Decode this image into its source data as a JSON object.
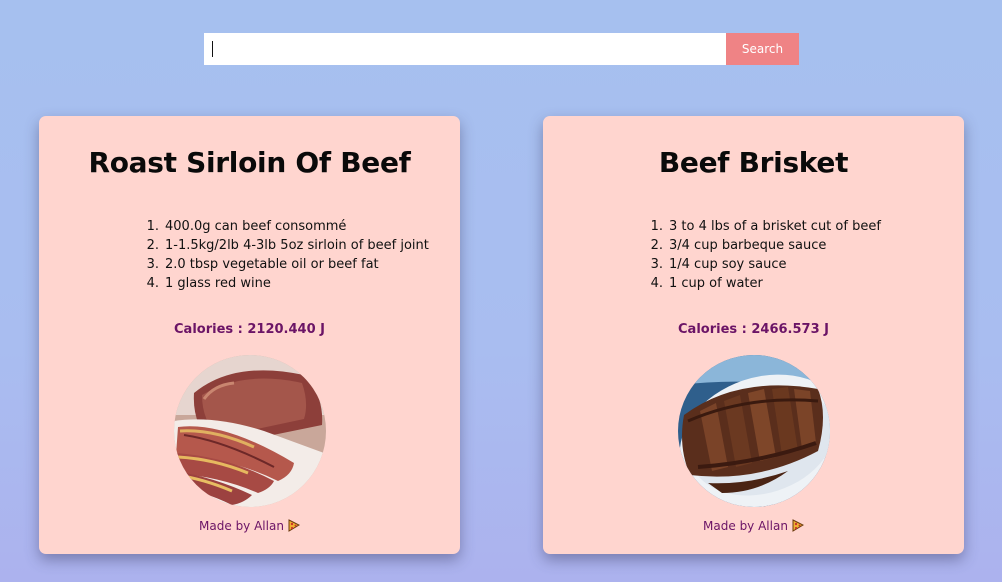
{
  "search": {
    "value": "",
    "placeholder": "",
    "button_label": "Search"
  },
  "recipes": [
    {
      "title": "Roast Sirloin Of Beef",
      "ingredients": [
        {
          "num": "1.",
          "text": "400.0g can beef consommé"
        },
        {
          "num": "2.",
          "text": "1-1.5kg/2lb 4-3lb 5oz sirloin of beef joint"
        },
        {
          "num": "3.",
          "text": "2.0 tbsp vegetable oil or beef fat"
        },
        {
          "num": "4.",
          "text": "1 glass red wine"
        }
      ],
      "calories": "Calories : 2120.440 J",
      "made_by": "Made by Allan",
      "made_by_icon": "pizza-icon"
    },
    {
      "title": "Beef Brisket",
      "ingredients": [
        {
          "num": "1.",
          "text": "3 to 4 lbs of a brisket cut of beef"
        },
        {
          "num": "2.",
          "text": "3/4 cup barbeque sauce"
        },
        {
          "num": "3.",
          "text": "1/4 cup soy sauce"
        },
        {
          "num": "4.",
          "text": "1 cup of water"
        }
      ],
      "calories": "Calories : 2466.573 J",
      "made_by": "Made by Allan",
      "made_by_icon": "pizza-icon"
    }
  ],
  "colors": {
    "background": "#a6c0ef",
    "card": "#ffd5cf",
    "search_button": "#ef8385",
    "accent_text": "#6b1466"
  }
}
